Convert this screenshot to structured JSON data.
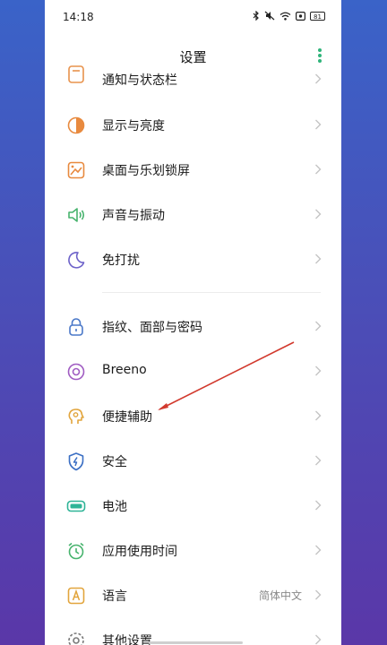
{
  "status_bar": {
    "time": "14:18",
    "battery": "81"
  },
  "header": {
    "title": "设置"
  },
  "items": [
    {
      "label": "通知与状态栏",
      "icon": "notification-icon",
      "color": "#e8934d"
    },
    {
      "label": "显示与亮度",
      "icon": "brightness-icon",
      "color": "#e88a3f"
    },
    {
      "label": "桌面与乐划锁屏",
      "icon": "wallpaper-icon",
      "color": "#e88a3f"
    },
    {
      "label": "声音与振动",
      "icon": "sound-icon",
      "color": "#47b36d"
    },
    {
      "label": "免打扰",
      "icon": "moon-icon",
      "color": "#6d62c9"
    },
    {
      "label": "指纹、面部与密码",
      "icon": "lock-icon",
      "color": "#4a78c8"
    },
    {
      "label": "Breeno",
      "icon": "breeno-icon",
      "color": "#a05cc2"
    },
    {
      "label": "便捷辅助",
      "icon": "assist-icon",
      "color": "#e2a53d"
    },
    {
      "label": "安全",
      "icon": "shield-icon",
      "color": "#3b6fc4"
    },
    {
      "label": "电池",
      "icon": "battery-icon",
      "color": "#2fb497"
    },
    {
      "label": "应用使用时间",
      "icon": "app-time-icon",
      "color": "#47b36d"
    },
    {
      "label": "语言",
      "value": "简体中文",
      "icon": "language-icon",
      "color": "#e2a53d"
    },
    {
      "label": "其他设置",
      "icon": "other-settings-icon",
      "color": "#7a7a7a"
    }
  ],
  "annotation": {
    "arrow_color": "#d23a2e"
  }
}
